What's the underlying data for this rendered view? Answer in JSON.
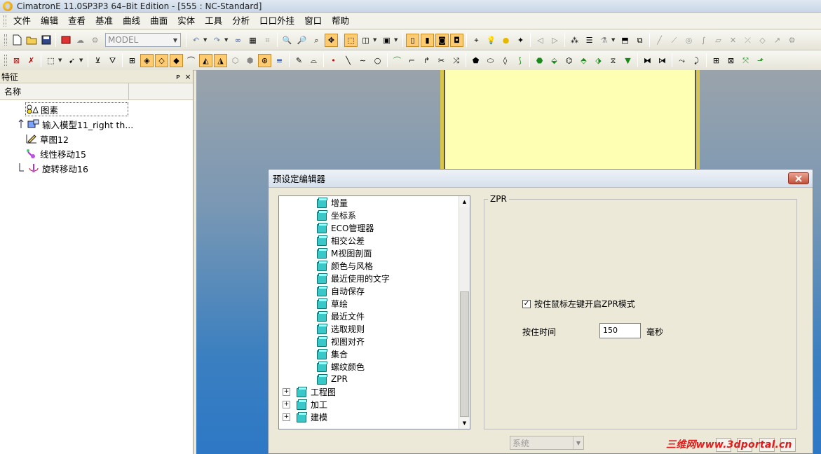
{
  "app": {
    "title": "CimatronE 11.0SP3P3 64–Bit Edition - [555 : NC-Standard]"
  },
  "menu": [
    "文件",
    "编辑",
    "查看",
    "基准",
    "曲线",
    "曲面",
    "实体",
    "工具",
    "分析",
    "口口外挂",
    "窗口",
    "帮助"
  ],
  "toolbar": {
    "model_combo": "MODEL"
  },
  "feature_panel": {
    "title": "特征",
    "pin": "ᴘ",
    "close": "×",
    "column": "名称",
    "items": [
      {
        "label": "图素",
        "icon": "layers-icon"
      },
      {
        "label": "输入模型11_right th...",
        "icon": "import-model-icon"
      },
      {
        "label": "草图12",
        "icon": "sketch-icon"
      },
      {
        "label": "线性移动15",
        "icon": "linear-move-icon"
      },
      {
        "label": "旋转移动16",
        "icon": "rotate-move-icon"
      }
    ]
  },
  "dialog": {
    "title": "预设定编辑器",
    "tree_children": [
      "增量",
      "坐标系",
      "ECO管理器",
      "相交公差",
      "M视图剖面",
      "颜色与风格",
      "最近使用的文字",
      "自动保存",
      "草绘",
      "最近文件",
      "选取规则",
      "视图对齐",
      "集合",
      "螺纹颜色",
      "ZPR"
    ],
    "tree_roots": [
      "工程图",
      "加工",
      "建模"
    ],
    "group_title": "ZPR",
    "checkbox_label": "按住鼠标左键开启ZPR模式",
    "checkbox_checked": "✓",
    "hold_label": "按住时间",
    "hold_value": "150",
    "hold_unit": "毫秒",
    "system_combo": "系统"
  },
  "watermark": "三维网www.3dportal.cn",
  "colors": {
    "accent": "#ffcb70",
    "part_face": "#ffffb4",
    "viewport_bottom": "#2d78c6"
  }
}
